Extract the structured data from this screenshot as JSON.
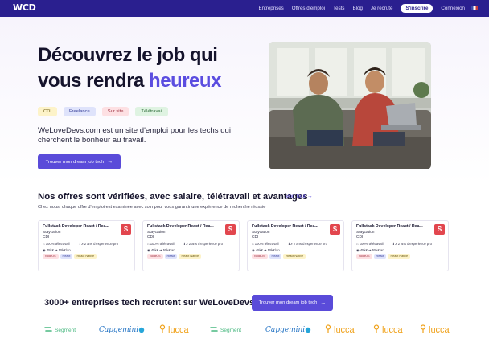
{
  "nav": {
    "logo": "WCD",
    "links": [
      "Entreprises",
      "Offres d'emploi",
      "Tests",
      "Blog",
      "Je recrute"
    ],
    "cta": "S'inscrire",
    "login": "Connexion"
  },
  "hero": {
    "title_part1": "Découvrez le job qui vous rendra ",
    "title_accent": "heureux",
    "tags": [
      "CDI",
      "Freelance",
      "Sur site",
      "Télétravail"
    ],
    "description": "WeLoveDevs.com est un site d'emploi pour les techs qui cherchent le bonheur au travail.",
    "cta": "Trouver mon dream job tech"
  },
  "offers": {
    "title": "Nos offres sont vérifiées, avec salaire, télétravail et avantages",
    "see_all": "Voir tout",
    "subtitle": "Chez nous, chaque offre d'emploi est examinée avec soin pour vous garantir une expérience de recherche réussie",
    "cards": [
      {
        "title": "Fullstack Developer React / Rea...",
        "company": "Staycation",
        "contract": "CDI",
        "remote": "100% télétravail",
        "experience": "≥ 2 ans d'experience pro",
        "salary": "45k€ ➔ 55k€/an",
        "chips": [
          "NodeJS",
          "React",
          "React Native"
        ],
        "logo_letter": "S"
      },
      {
        "title": "Fullstack Developer React / Rea...",
        "company": "Staycation",
        "contract": "CDI",
        "remote": "100% télétravail",
        "experience": "≥ 2 ans d'experience pro",
        "salary": "45k€ ➔ 55k€/an",
        "chips": [
          "NodeJS",
          "React",
          "React Native"
        ],
        "logo_letter": "S"
      },
      {
        "title": "Fullstack Developer React / Rea...",
        "company": "Staycation",
        "contract": "CDI",
        "remote": "100% télétravail",
        "experience": "≥ 2 ans d'experience pro",
        "salary": "45k€ ➔ 55k€/an",
        "chips": [
          "NodeJS",
          "React",
          "React Native"
        ],
        "logo_letter": "S"
      },
      {
        "title": "Fullstack Developer React / Rea...",
        "company": "Staycation",
        "contract": "CDI",
        "remote": "100% télétravail",
        "experience": "≥ 2 ans d'experience pro",
        "salary": "45k€ ➔ 55k€/an",
        "chips": [
          "NodeJS",
          "React",
          "React Native"
        ],
        "logo_letter": "S"
      }
    ]
  },
  "companies": {
    "title": "3000+ entreprises tech recrutent sur WeLoveDevs",
    "cta": "Trouver mon dream job tech",
    "logos": [
      "Segment",
      "Capgemini",
      "lucca",
      "Segment",
      "Capgemini",
      "lucca",
      "lucca",
      "lucca"
    ]
  },
  "colors": {
    "nav_bg": "#2a1f8f",
    "accent": "#5b4de0",
    "button": "#5a4bd9",
    "logo_red": "#e2464e"
  }
}
